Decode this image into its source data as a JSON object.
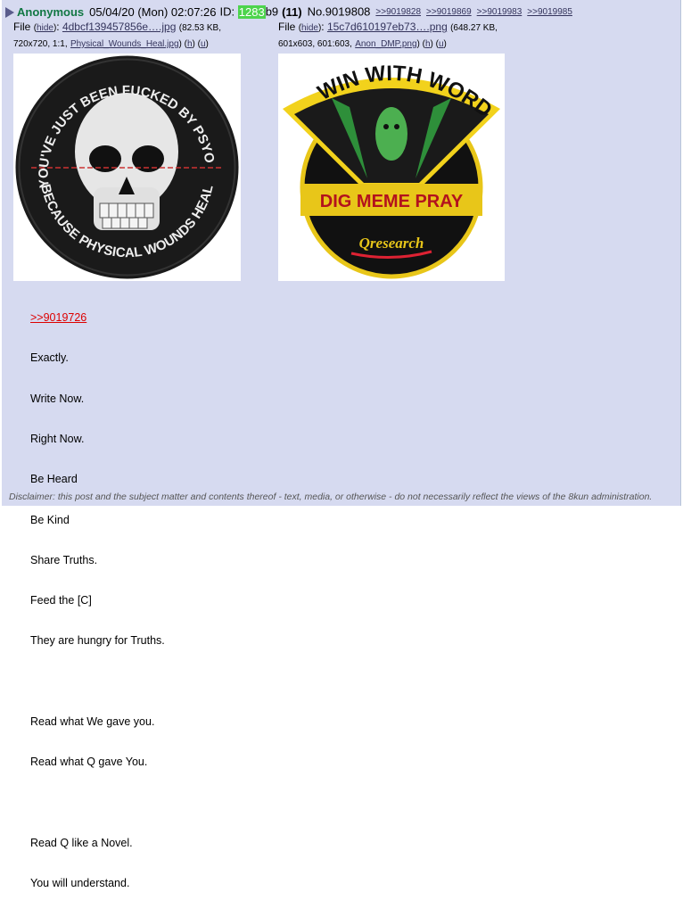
{
  "post": {
    "name": "Anonymous",
    "date": "05/04/20 (Mon) 02:07:26",
    "id_label": "ID:",
    "id_highlight": "1283",
    "id_rest": "b9",
    "reply_count": "(11)",
    "post_number": "No.9019808",
    "backlinks": [
      ">>9019828",
      ">>9019869",
      ">>9019983",
      ">>9019985"
    ]
  },
  "files": [
    {
      "label": "File",
      "hide": "hide",
      "filename": "4dbcf139457856e….jpg",
      "size": "(82.53 KB,",
      "dims": "720x720, 1:1,",
      "original_name": "Physical_Wounds_Heal.jpg",
      "h": "h",
      "u": "u",
      "image": {
        "top_text": "YOU'VE JUST BEEN FUCKED BY PSYOPS",
        "bottom_text": "BECAUSE PHYSICAL WOUNDS HEAL"
      }
    },
    {
      "label": "File",
      "hide": "hide",
      "filename": "15c7d610197eb73….png",
      "size": "(648.27 KB,",
      "dims": "601x603, 601:603,",
      "original_name": "Anon_DMP.png",
      "h": "h",
      "u": "u",
      "image": {
        "top_text": "WIN WITH WORDS",
        "middle_text": "DIG MEME PRAY",
        "logo_text": "Qresearch"
      }
    }
  ],
  "body": {
    "quote": ">>9019726",
    "lines": [
      "Exactly.",
      "Write Now.",
      "Right Now.",
      "Be Heard",
      "Be Kind",
      "Share Truths.",
      "Feed the [C]",
      "They are hungry for Truths.",
      "",
      "Read what We gave you.",
      "Read what Q gave You.",
      "",
      "Read Q like a Novel.",
      "You will understand."
    ]
  },
  "disclaimer": "Disclaimer: this post and the subject matter and contents thereof - text, media, or otherwise - do not necessarily reflect the views of the 8kun administration.",
  "colors": {
    "post_bg": "#d6daf0",
    "name": "#117743",
    "id_highlight_bg": "#4dd44d",
    "link": "#34345c",
    "quote_link": "#dd0000"
  }
}
